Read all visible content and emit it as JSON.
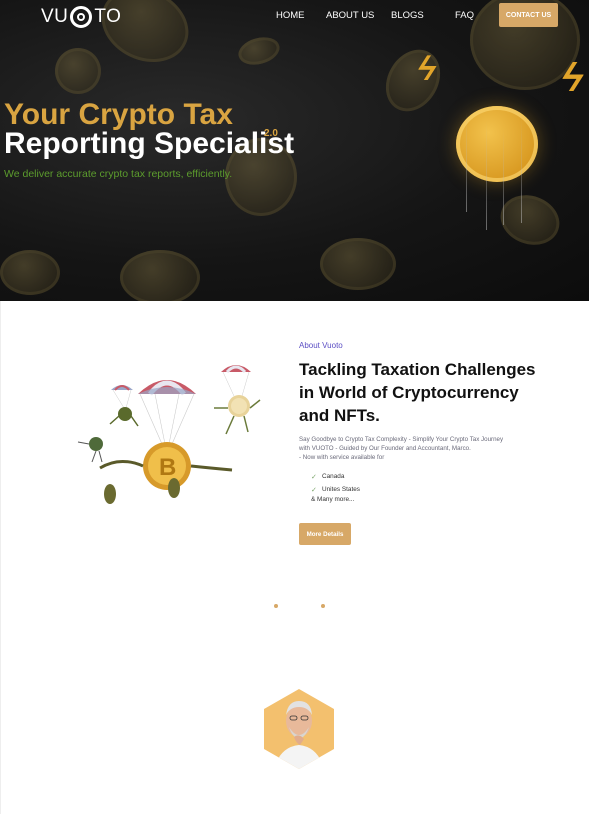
{
  "brand": {
    "logo_left": "VU",
    "logo_right": "TO"
  },
  "nav": {
    "links": [
      {
        "label": "HOME"
      },
      {
        "label": "ABOUT US"
      },
      {
        "label": "BLOGS"
      },
      {
        "label": "FAQ"
      }
    ],
    "contact_label": "CONTACT US"
  },
  "hero": {
    "title_line1": "Your Crypto Tax",
    "title_line2": "Reporting Specialist",
    "version": "2.0",
    "subtitle": "We deliver accurate crypto tax reports, efficiently."
  },
  "about": {
    "kicker": "About Vuoto",
    "title": "Tackling Taxation Challenges in World of Cryptocurrency and NFTs.",
    "description_lines": [
      "Say Goodbye to Crypto Tax Complexity - Simplify Your Crypto Tax Journey",
      "with VUOTO - Guided by Our Founder and Accountant, Marco.",
      "- Now with service available for"
    ],
    "countries": [
      "Canada",
      "Unites States"
    ],
    "more": "& Many more...",
    "button_label": "More Details"
  },
  "colors": {
    "accent": "#d7a867",
    "gold_title": "#d9a441",
    "green_subtitle": "#5c9c2d",
    "kicker_purple": "#5b4ec4"
  },
  "icons": {
    "check": "check-icon",
    "logo_ring": "logo-ring-icon"
  }
}
